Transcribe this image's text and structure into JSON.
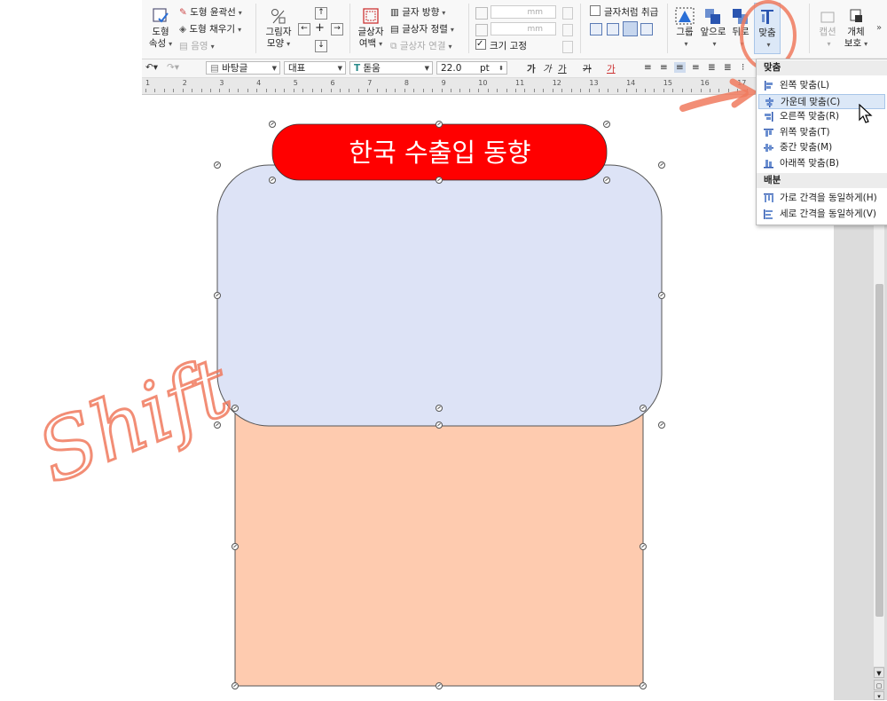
{
  "ribbon": {
    "shape_props": {
      "line1": "도형",
      "line2": "속성"
    },
    "shape_outline": "도형 윤곽선",
    "shape_fill": "도형 채우기",
    "shadow": "음영",
    "shadow_shape": {
      "line1": "그림자",
      "line2": "모양"
    },
    "textbox_margin": {
      "line1": "글상자",
      "line2": "여백"
    },
    "text_direction": "글자 방향",
    "textbox_align": "글상자 정렬",
    "textbox_link": "글상자 연결",
    "unit_mm_1": "mm",
    "unit_mm_2": "mm",
    "fix_size": "크기 고정",
    "treat_as_char": "글자처럼 취급",
    "group": "그룹",
    "bring_front": "앞으로",
    "send_back": "뒤로",
    "align": "맞춤",
    "caption": {
      "line1": "캡션"
    },
    "object_protect": {
      "line1": "개체",
      "line2": "보호"
    },
    "more": "»"
  },
  "format_bar": {
    "style": "바탕글",
    "language": "대표",
    "font": "돋움",
    "size": "22.0",
    "unit": "pt",
    "bold": "가",
    "italic": "가",
    "underline": "가",
    "strike": "가",
    "color_text": "가"
  },
  "ruler": {
    "numbers": [
      "1",
      "2",
      "3",
      "4",
      "5",
      "6",
      "7",
      "8",
      "9",
      "10",
      "11",
      "12",
      "13",
      "14",
      "15",
      "16",
      "17"
    ]
  },
  "canvas": {
    "title_text": "한국  수출입  동향",
    "colors": {
      "title_bg": "#ff0000",
      "blue_box": "#dde3f6",
      "orange_box": "#fecbaf"
    },
    "annotation": "Shift"
  },
  "dropdown": {
    "header": "맞춤",
    "items": [
      {
        "label": "왼쪽 맞춤(L)",
        "icon": "align-left-icon"
      },
      {
        "label": "가운데 맞춤(C)",
        "icon": "align-center-icon"
      },
      {
        "label": "오른쪽 맞춤(R)",
        "icon": "align-right-icon"
      },
      {
        "label": "위쪽 맞춤(T)",
        "icon": "align-top-icon"
      },
      {
        "label": "중간 맞춤(M)",
        "icon": "align-middle-icon"
      },
      {
        "label": "아래쪽 맞춤(B)",
        "icon": "align-bottom-icon"
      }
    ],
    "section2_header": "배분",
    "items2": [
      {
        "label": "가로 간격을 동일하게(H)",
        "icon": "distribute-horizontal-icon"
      },
      {
        "label": "세로 간격을 동일하게(V)",
        "icon": "distribute-vertical-icon"
      }
    ]
  }
}
